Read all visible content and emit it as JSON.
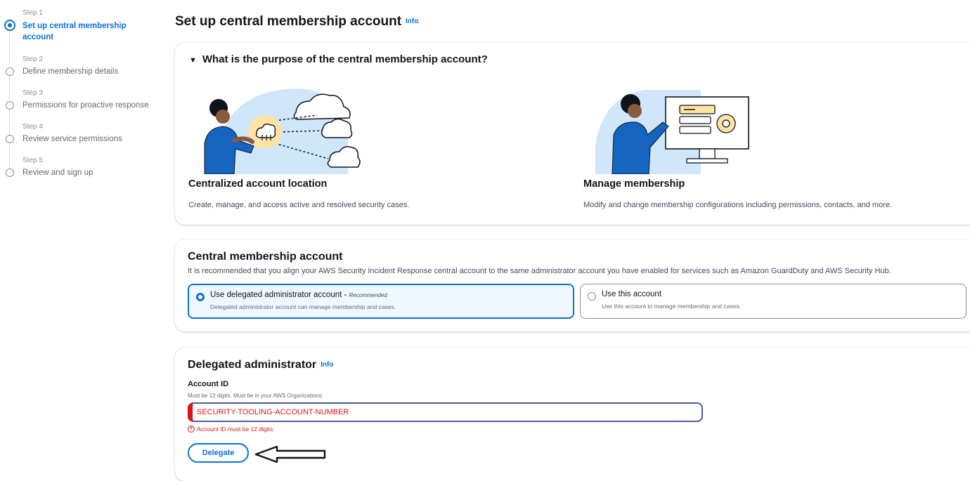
{
  "steps": [
    {
      "num": "Step 1",
      "label": "Set up central membership account",
      "active": true
    },
    {
      "num": "Step 2",
      "label": "Define membership details"
    },
    {
      "num": "Step 3",
      "label": "Permissions for proactive response"
    },
    {
      "num": "Step 4",
      "label": "Review service permissions"
    },
    {
      "num": "Step 5",
      "label": "Review and sign up"
    }
  ],
  "page": {
    "title": "Set up central membership account",
    "info": "Info"
  },
  "purpose": {
    "title": "What is the purpose of the central membership account?",
    "features": [
      {
        "title": "Centralized account location",
        "desc": "Create, manage, and access active and resolved security cases.",
        "icon": "cloud-network-illustration"
      },
      {
        "title": "Manage membership",
        "desc": "Modify and change membership configurations including permissions, contacts, and more.",
        "icon": "settings-monitor-illustration"
      }
    ]
  },
  "central": {
    "title": "Central membership account",
    "desc": "It is recommended that you align your AWS Security Incident Response central account to the same administrator account you have enabled for services such as Amazon GuardDuty and AWS Security Hub.",
    "options": [
      {
        "label": "Use delegated administrator account - ",
        "tag": "Recommended",
        "sub": "Delegated administrator account can manage membership and cases.",
        "selected": true
      },
      {
        "label": "Use this account",
        "tag": "",
        "sub": "Use this account to manage membership and cases.",
        "selected": false
      }
    ]
  },
  "delegated": {
    "title": "Delegated administrator",
    "info": "Info",
    "field_label": "Account ID",
    "field_hint": "Must be 12 digits. Must be in your AWS Organizations.",
    "value": "SECURITY-TOOLING-ACCOUNT-NUMBER",
    "error": "Account ID must be 12 digits",
    "button": "Delegate"
  },
  "colors": {
    "accent": "#0972d3",
    "error": "#d91515"
  }
}
